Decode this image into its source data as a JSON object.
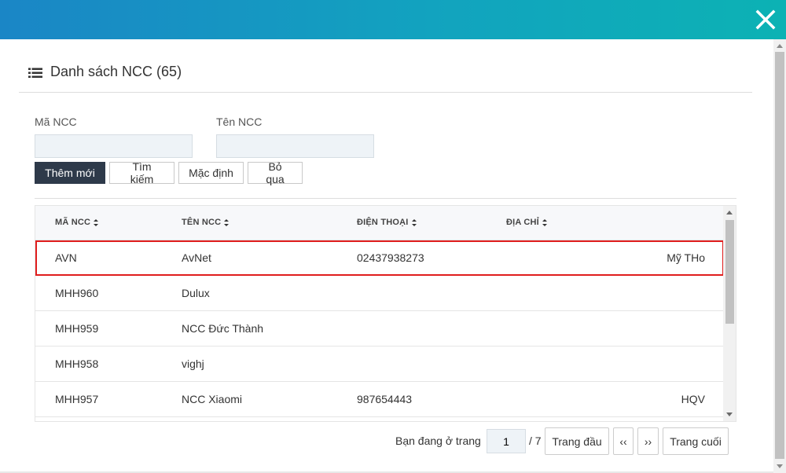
{
  "header": {
    "title": "Danh sách NCC (65)",
    "brand_gradient": [
      "#1a86c6",
      "#0cb2b4"
    ]
  },
  "icons": {
    "close": "close-icon",
    "list": "list-icon",
    "sort": "sort-icon"
  },
  "filters": {
    "code_label": "Mã NCC",
    "code_value": "",
    "name_label": "Tên NCC",
    "name_value": ""
  },
  "buttons": {
    "add": "Thêm mới",
    "search": "Tìm kiếm",
    "default": "Mặc định",
    "skip": "Bỏ qua"
  },
  "table": {
    "columns": [
      "MÃ NCC",
      "TÊN NCC",
      "ĐIỆN THOẠI",
      "ĐỊA CHỈ"
    ],
    "rows": [
      {
        "code": "AVN",
        "name": "AvNet",
        "phone": "02437938273",
        "address": "Mỹ THo",
        "selected": true
      },
      {
        "code": "MHH960",
        "name": "Dulux",
        "phone": "",
        "address": ""
      },
      {
        "code": "MHH959",
        "name": "NCC Đức Thành",
        "phone": "",
        "address": ""
      },
      {
        "code": "MHH958",
        "name": "vighj",
        "phone": "",
        "address": ""
      },
      {
        "code": "MHH957",
        "name": "NCC Xiaomi",
        "phone": "987654443",
        "address": "HQV"
      }
    ],
    "highlight_color": "#e01e1e"
  },
  "pagination": {
    "prefix": "Bạn đang ở trang",
    "current_page": "1",
    "total": "/ 7",
    "first": "Trang đầu",
    "prev": "‹‹",
    "next": "››",
    "last": "Trang cuối"
  }
}
